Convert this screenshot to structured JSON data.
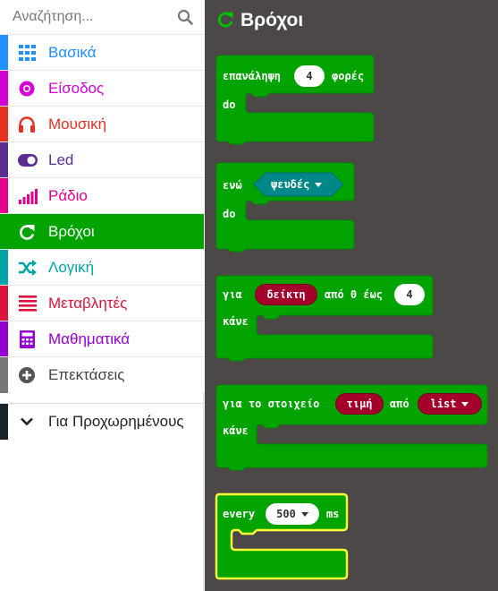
{
  "search": {
    "placeholder": "Αναζήτηση..."
  },
  "categories": [
    {
      "label": "Βασικά",
      "color": "#1e90ff",
      "icon": "grid-icon",
      "active": false
    },
    {
      "label": "Είσοδος",
      "color": "#d400d4",
      "icon": "input-circle-icon",
      "active": false
    },
    {
      "label": "Μουσική",
      "color": "#e63022",
      "icon": "headphones-icon",
      "active": false
    },
    {
      "label": "Led",
      "color": "#5c2d91",
      "icon": "toggle-icon",
      "active": false
    },
    {
      "label": "Ράδιο",
      "color": "#e3008c",
      "icon": "signal-bars-icon",
      "active": false
    },
    {
      "label": "Βρόχοι",
      "color": "#00a300",
      "icon": "refresh-icon",
      "active": true
    },
    {
      "label": "Λογική",
      "color": "#00a4a6",
      "icon": "shuffle-icon",
      "active": false
    },
    {
      "label": "Μεταβλητές",
      "color": "#dc143c",
      "icon": "list-lines-icon",
      "active": false
    },
    {
      "label": "Μαθηματικά",
      "color": "#9400d3",
      "icon": "calculator-icon",
      "active": false
    },
    {
      "label": "Επεκτάσεις",
      "color": "#777777",
      "icon": "plus-circle-icon",
      "active": false
    }
  ],
  "advanced": {
    "label": "Για Προχωρημένους"
  },
  "flyout": {
    "title": "Βρόχοι",
    "repeat": {
      "prefix": "επανάληψη",
      "count": "4",
      "suffix": "φορές",
      "do": "do"
    },
    "while": {
      "prefix": "ενώ",
      "condition": "ψευδές",
      "do": "do"
    },
    "for": {
      "prefix": "για",
      "variable": "δείκτη",
      "middle": "από 0 έως",
      "end": "4",
      "do": "κάνε"
    },
    "foreach": {
      "prefix": "για το στοιχείο",
      "variable": "τιμή",
      "middle": "από",
      "list": "list",
      "do": "κάνε"
    },
    "every": {
      "prefix": "every",
      "interval": "500",
      "suffix": "ms"
    }
  },
  "colors": {
    "loops": "#00a300",
    "loops_border": "#008a00",
    "highlight": "#ffff33",
    "flyout_bg": "#4d4848"
  }
}
